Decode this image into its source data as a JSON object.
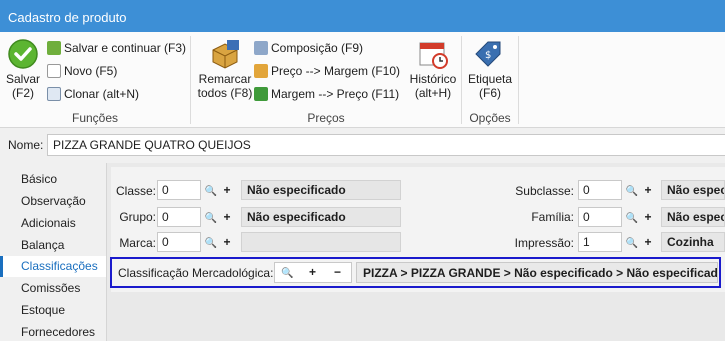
{
  "window": {
    "title": "Cadastro de produto"
  },
  "ribbon": {
    "funcoes": {
      "label": "Funções",
      "salvar": "Salvar\n(F2)",
      "salvar_continuar": "Salvar e continuar (F3)",
      "novo": "Novo (F5)",
      "clonar": "Clonar (alt+N)"
    },
    "precos": {
      "label": "Preços",
      "remarcar": "Remarcar\ntodos (F8)",
      "composicao": "Composição (F9)",
      "preco_margem": "Preço --> Margem (F10)",
      "margem_preco": "Margem --> Preço (F11)",
      "historico": "Histórico\n(alt+H)"
    },
    "opcoes": {
      "label": "Opções",
      "etiqueta": "Etiqueta\n(F6)"
    }
  },
  "name": {
    "label": "Nome:",
    "value": "PIZZA GRANDE QUATRO QUEIJOS"
  },
  "sidebar": {
    "items": [
      {
        "label": "Básico"
      },
      {
        "label": "Observação"
      },
      {
        "label": "Adicionais"
      },
      {
        "label": "Balança"
      },
      {
        "label": "Classificações"
      },
      {
        "label": "Comissões"
      },
      {
        "label": "Estoque"
      },
      {
        "label": "Fornecedores"
      }
    ]
  },
  "form": {
    "classe": {
      "label": "Classe:",
      "value": "0",
      "desc": "Não especificado"
    },
    "grupo": {
      "label": "Grupo:",
      "value": "0",
      "desc": "Não especificado"
    },
    "marca": {
      "label": "Marca:",
      "value": "0",
      "desc": ""
    },
    "subclasse": {
      "label": "Subclasse:",
      "value": "0",
      "desc": "Não especificado"
    },
    "familia": {
      "label": "Família:",
      "value": "0",
      "desc": "Não especificado"
    },
    "impressao": {
      "label": "Impressão:",
      "value": "1",
      "desc": "Cozinha"
    },
    "search_glyph": "🔍",
    "add_glyph": "+"
  },
  "mercadologica": {
    "label": "Classificação Mercadológica:",
    "plus": "+",
    "minus": "−",
    "path": "PIZZA  > PIZZA GRANDE > Não especificado > Não especificado"
  },
  "colors": {
    "titlebar": "#3d8fd6",
    "accent": "#1a6fbf",
    "highlight_border": "#1a1acc"
  }
}
